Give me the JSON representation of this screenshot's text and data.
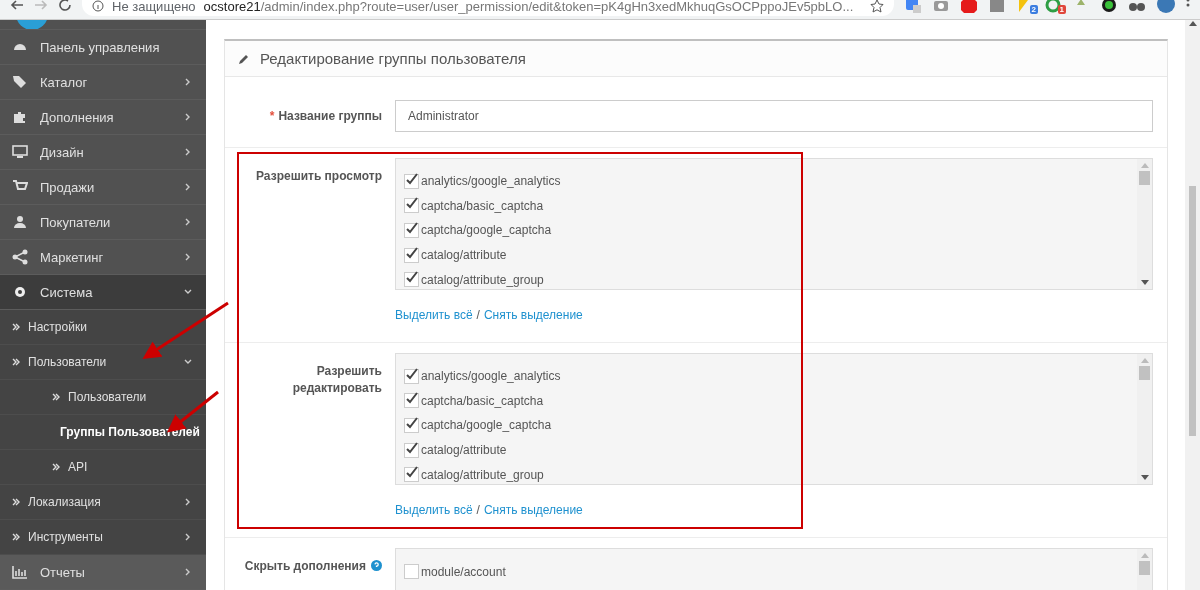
{
  "browser": {
    "security": "Не защищено",
    "url_host": "ocstore21",
    "url_path": "/admin/index.php?route=user/user_permission/edit&token=pK4gHn3xedMkhuqGsOCPppoJEv5pbLO...",
    "extensions": [
      {
        "kind": "translate"
      },
      {
        "kind": "camera"
      },
      {
        "kind": "stop"
      },
      {
        "kind": "square"
      },
      {
        "kind": "flag",
        "badge": "2"
      },
      {
        "kind": "ring",
        "badge": "1"
      },
      {
        "kind": "pin"
      },
      {
        "kind": "dark"
      },
      {
        "kind": "binoculars"
      }
    ]
  },
  "sidebar": {
    "items": [
      {
        "label": "Панель управления",
        "has_children": false,
        "expanded": false
      },
      {
        "label": "Каталог",
        "has_children": true,
        "expanded": false
      },
      {
        "label": "Дополнения",
        "has_children": true,
        "expanded": false
      },
      {
        "label": "Дизайн",
        "has_children": true,
        "expanded": false
      },
      {
        "label": "Продажи",
        "has_children": true,
        "expanded": false
      },
      {
        "label": "Покупатели",
        "has_children": true,
        "expanded": false
      },
      {
        "label": "Маркетинг",
        "has_children": true,
        "expanded": false
      },
      {
        "label": "Система",
        "has_children": true,
        "expanded": true,
        "children": [
          {
            "label": "Настройки",
            "has_children": false,
            "expanded": false,
            "selected": false
          },
          {
            "label": "Пользователи",
            "has_children": true,
            "expanded": true,
            "selected": false,
            "children": [
              {
                "label": "Пользователи",
                "selected": false
              },
              {
                "label": "Группы Пользователей",
                "selected": true
              },
              {
                "label": "API",
                "selected": false
              }
            ]
          },
          {
            "label": "Локализация",
            "has_children": true,
            "expanded": false,
            "selected": false
          },
          {
            "label": "Инструменты",
            "has_children": true,
            "expanded": false,
            "selected": false
          }
        ]
      },
      {
        "label": "Отчеты",
        "has_children": true,
        "expanded": false
      }
    ]
  },
  "panel": {
    "title": "Редактирование группы пользователя",
    "group_name": {
      "required_mark": "*",
      "label": "Название группы",
      "value": "Administrator"
    },
    "permissions": [
      {
        "label": "Разрешить просмотр",
        "help": false,
        "items": [
          {
            "label": "analytics/google_analytics",
            "checked": true
          },
          {
            "label": "captcha/basic_captcha",
            "checked": true
          },
          {
            "label": "captcha/google_captcha",
            "checked": true
          },
          {
            "label": "catalog/attribute",
            "checked": true
          },
          {
            "label": "catalog/attribute_group",
            "checked": true
          }
        ],
        "select_all": "Выделить всё",
        "separator": "/",
        "deselect_all": "Снять выделение"
      },
      {
        "label": "Разрешить редактировать",
        "help": false,
        "items": [
          {
            "label": "analytics/google_analytics",
            "checked": true
          },
          {
            "label": "captcha/basic_captcha",
            "checked": true
          },
          {
            "label": "captcha/google_captcha",
            "checked": true
          },
          {
            "label": "catalog/attribute",
            "checked": true
          },
          {
            "label": "catalog/attribute_group",
            "checked": true
          }
        ],
        "select_all": "Выделить всё",
        "separator": "/",
        "deselect_all": "Снять выделение"
      },
      {
        "label": "Скрыть дополнения",
        "help": true,
        "items": [
          {
            "label": "module/account",
            "checked": false
          }
        ]
      }
    ]
  }
}
